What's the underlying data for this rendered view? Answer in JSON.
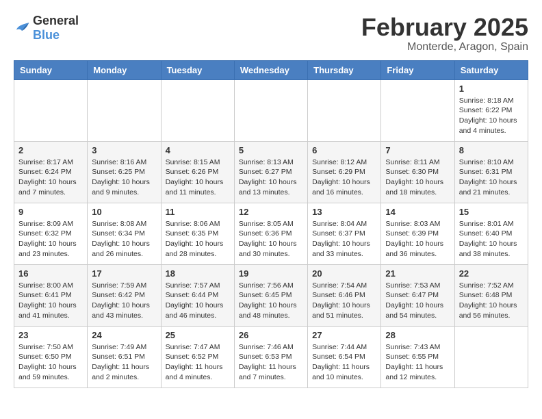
{
  "logo": {
    "text_general": "General",
    "text_blue": "Blue"
  },
  "header": {
    "title": "February 2025",
    "subtitle": "Monterde, Aragon, Spain"
  },
  "days_of_week": [
    "Sunday",
    "Monday",
    "Tuesday",
    "Wednesday",
    "Thursday",
    "Friday",
    "Saturday"
  ],
  "weeks": [
    [
      {
        "day": "",
        "info": ""
      },
      {
        "day": "",
        "info": ""
      },
      {
        "day": "",
        "info": ""
      },
      {
        "day": "",
        "info": ""
      },
      {
        "day": "",
        "info": ""
      },
      {
        "day": "",
        "info": ""
      },
      {
        "day": "1",
        "info": "Sunrise: 8:18 AM\nSunset: 6:22 PM\nDaylight: 10 hours and 4 minutes."
      }
    ],
    [
      {
        "day": "2",
        "info": "Sunrise: 8:17 AM\nSunset: 6:24 PM\nDaylight: 10 hours and 7 minutes."
      },
      {
        "day": "3",
        "info": "Sunrise: 8:16 AM\nSunset: 6:25 PM\nDaylight: 10 hours and 9 minutes."
      },
      {
        "day": "4",
        "info": "Sunrise: 8:15 AM\nSunset: 6:26 PM\nDaylight: 10 hours and 11 minutes."
      },
      {
        "day": "5",
        "info": "Sunrise: 8:13 AM\nSunset: 6:27 PM\nDaylight: 10 hours and 13 minutes."
      },
      {
        "day": "6",
        "info": "Sunrise: 8:12 AM\nSunset: 6:29 PM\nDaylight: 10 hours and 16 minutes."
      },
      {
        "day": "7",
        "info": "Sunrise: 8:11 AM\nSunset: 6:30 PM\nDaylight: 10 hours and 18 minutes."
      },
      {
        "day": "8",
        "info": "Sunrise: 8:10 AM\nSunset: 6:31 PM\nDaylight: 10 hours and 21 minutes."
      }
    ],
    [
      {
        "day": "9",
        "info": "Sunrise: 8:09 AM\nSunset: 6:32 PM\nDaylight: 10 hours and 23 minutes."
      },
      {
        "day": "10",
        "info": "Sunrise: 8:08 AM\nSunset: 6:34 PM\nDaylight: 10 hours and 26 minutes."
      },
      {
        "day": "11",
        "info": "Sunrise: 8:06 AM\nSunset: 6:35 PM\nDaylight: 10 hours and 28 minutes."
      },
      {
        "day": "12",
        "info": "Sunrise: 8:05 AM\nSunset: 6:36 PM\nDaylight: 10 hours and 30 minutes."
      },
      {
        "day": "13",
        "info": "Sunrise: 8:04 AM\nSunset: 6:37 PM\nDaylight: 10 hours and 33 minutes."
      },
      {
        "day": "14",
        "info": "Sunrise: 8:03 AM\nSunset: 6:39 PM\nDaylight: 10 hours and 36 minutes."
      },
      {
        "day": "15",
        "info": "Sunrise: 8:01 AM\nSunset: 6:40 PM\nDaylight: 10 hours and 38 minutes."
      }
    ],
    [
      {
        "day": "16",
        "info": "Sunrise: 8:00 AM\nSunset: 6:41 PM\nDaylight: 10 hours and 41 minutes."
      },
      {
        "day": "17",
        "info": "Sunrise: 7:59 AM\nSunset: 6:42 PM\nDaylight: 10 hours and 43 minutes."
      },
      {
        "day": "18",
        "info": "Sunrise: 7:57 AM\nSunset: 6:44 PM\nDaylight: 10 hours and 46 minutes."
      },
      {
        "day": "19",
        "info": "Sunrise: 7:56 AM\nSunset: 6:45 PM\nDaylight: 10 hours and 48 minutes."
      },
      {
        "day": "20",
        "info": "Sunrise: 7:54 AM\nSunset: 6:46 PM\nDaylight: 10 hours and 51 minutes."
      },
      {
        "day": "21",
        "info": "Sunrise: 7:53 AM\nSunset: 6:47 PM\nDaylight: 10 hours and 54 minutes."
      },
      {
        "day": "22",
        "info": "Sunrise: 7:52 AM\nSunset: 6:48 PM\nDaylight: 10 hours and 56 minutes."
      }
    ],
    [
      {
        "day": "23",
        "info": "Sunrise: 7:50 AM\nSunset: 6:50 PM\nDaylight: 10 hours and 59 minutes."
      },
      {
        "day": "24",
        "info": "Sunrise: 7:49 AM\nSunset: 6:51 PM\nDaylight: 11 hours and 2 minutes."
      },
      {
        "day": "25",
        "info": "Sunrise: 7:47 AM\nSunset: 6:52 PM\nDaylight: 11 hours and 4 minutes."
      },
      {
        "day": "26",
        "info": "Sunrise: 7:46 AM\nSunset: 6:53 PM\nDaylight: 11 hours and 7 minutes."
      },
      {
        "day": "27",
        "info": "Sunrise: 7:44 AM\nSunset: 6:54 PM\nDaylight: 11 hours and 10 minutes."
      },
      {
        "day": "28",
        "info": "Sunrise: 7:43 AM\nSunset: 6:55 PM\nDaylight: 11 hours and 12 minutes."
      },
      {
        "day": "",
        "info": ""
      }
    ]
  ]
}
